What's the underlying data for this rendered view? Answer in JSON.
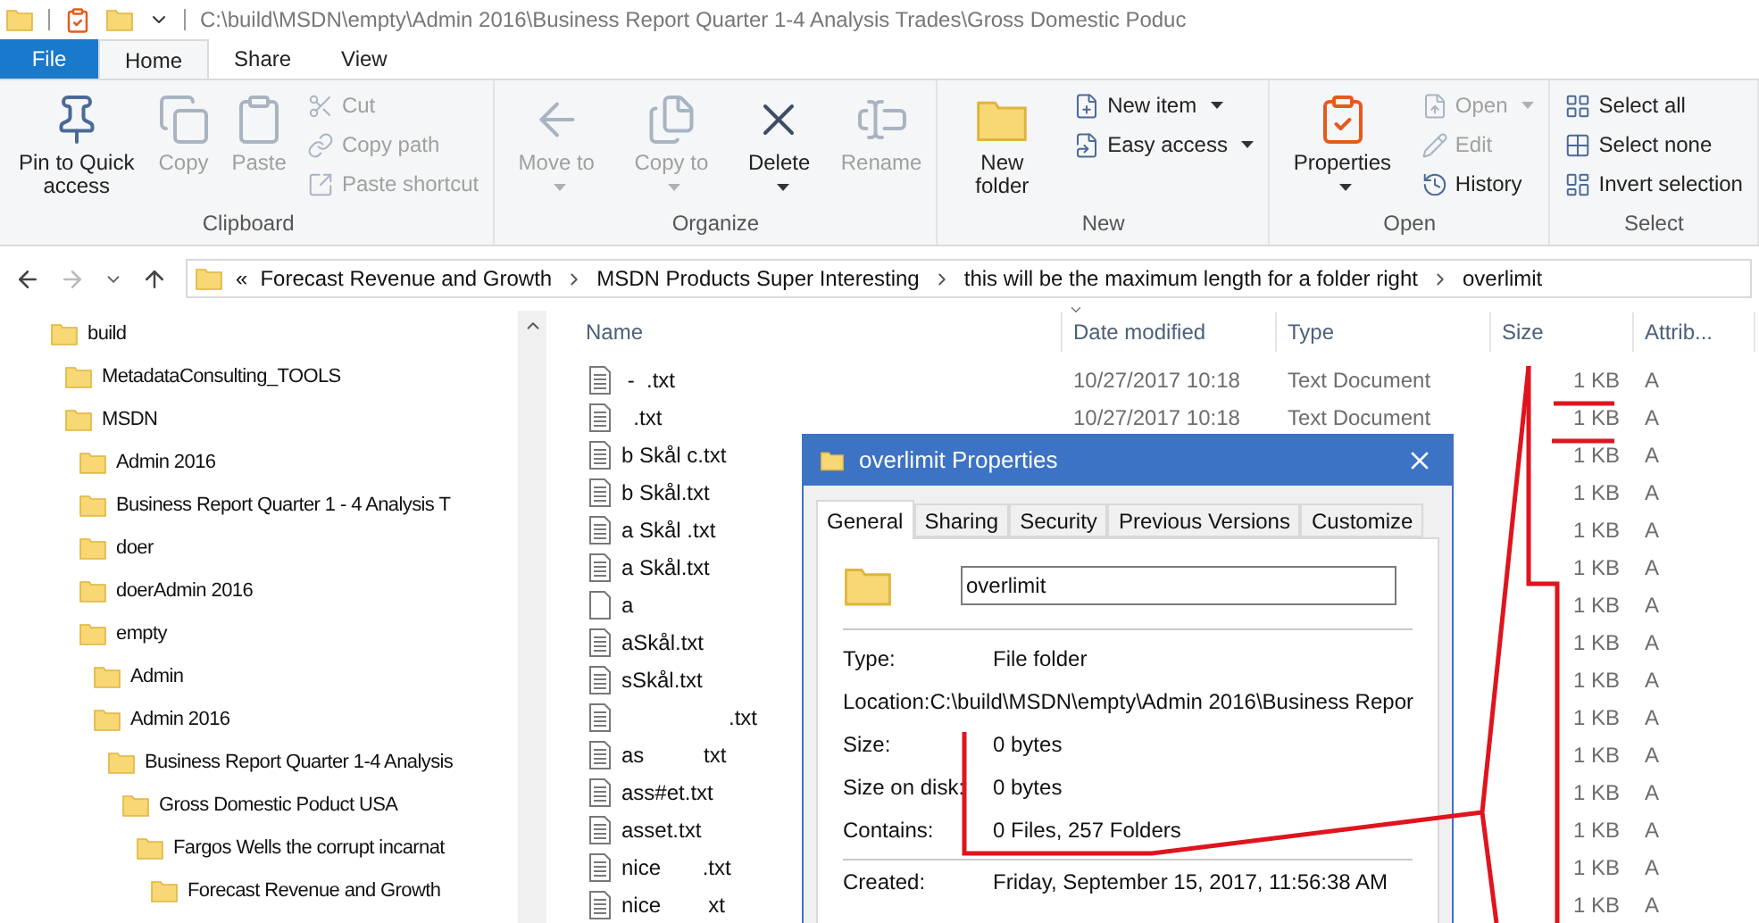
{
  "title_bar": {
    "path": "C:\\build\\MSDN\\empty\\Admin 2016\\Business Report Quarter 1-4 Analysis Trades\\Gross Domestic Poduc"
  },
  "ribbon_tabs": [
    {
      "label": "File",
      "kind": "file",
      "selected": false
    },
    {
      "label": "Home",
      "kind": "tab",
      "selected": true
    },
    {
      "label": "Share",
      "kind": "tab",
      "selected": false
    },
    {
      "label": "View",
      "kind": "tab",
      "selected": false
    }
  ],
  "ribbon_groups": [
    {
      "label": "Clipboard",
      "items": [
        {
          "label": "Pin to Quick access",
          "kind": "large",
          "disabled": false,
          "dropdown": false
        },
        {
          "label": "Copy",
          "kind": "large",
          "disabled": true,
          "dropdown": false
        },
        {
          "label": "Paste",
          "kind": "large",
          "disabled": true,
          "dropdown": false
        },
        {
          "label": "Cut",
          "kind": "small",
          "disabled": true,
          "dropdown": false
        },
        {
          "label": "Copy path",
          "kind": "small",
          "disabled": true,
          "dropdown": false
        },
        {
          "label": "Paste shortcut",
          "kind": "small",
          "disabled": true,
          "dropdown": false
        }
      ]
    },
    {
      "label": "Organize",
      "items": [
        {
          "label": "Move to",
          "kind": "large",
          "disabled": true,
          "dropdown": true
        },
        {
          "label": "Copy to",
          "kind": "large",
          "disabled": true,
          "dropdown": true
        },
        {
          "label": "Delete",
          "kind": "large",
          "disabled": false,
          "dropdown": true
        },
        {
          "label": "Rename",
          "kind": "large",
          "disabled": true,
          "dropdown": false
        }
      ]
    },
    {
      "label": "New",
      "items": [
        {
          "label": "New folder",
          "kind": "large",
          "disabled": false,
          "dropdown": false
        },
        {
          "label": "New item",
          "kind": "small",
          "disabled": false,
          "dropdown": true
        },
        {
          "label": "Easy access",
          "kind": "small",
          "disabled": false,
          "dropdown": true
        }
      ]
    },
    {
      "label": "Open",
      "items": [
        {
          "label": "Properties",
          "kind": "large",
          "disabled": false,
          "dropdown": true
        },
        {
          "label": "Open",
          "kind": "small",
          "disabled": true,
          "dropdown": true
        },
        {
          "label": "Edit",
          "kind": "small",
          "disabled": true,
          "dropdown": false
        },
        {
          "label": "History",
          "kind": "small",
          "disabled": false,
          "dropdown": false
        }
      ]
    },
    {
      "label": "Select",
      "items": [
        {
          "label": "Select all",
          "kind": "small",
          "disabled": false,
          "dropdown": false
        },
        {
          "label": "Select none",
          "kind": "small",
          "disabled": false,
          "dropdown": false
        },
        {
          "label": "Invert selection",
          "kind": "small",
          "disabled": false,
          "dropdown": false
        }
      ]
    }
  ],
  "address_bar": {
    "overflow": "«",
    "crumbs": [
      "Forecast Revenue and Growth",
      "MSDN Products Super Interesting",
      "this will be the maximum length for a folder right",
      "overlimit"
    ]
  },
  "nav_tree": [
    {
      "label": "build",
      "children": [
        {
          "label": "MetadataConsulting_TOOLS"
        },
        {
          "label": "MSDN",
          "children": [
            {
              "label": "Admin 2016"
            },
            {
              "label": "Business Report Quarter 1 - 4 Analysis T"
            },
            {
              "label": "doer"
            },
            {
              "label": "doerAdmin 2016"
            },
            {
              "label": "empty",
              "children": [
                {
                  "label": "Admin"
                },
                {
                  "label": "Admin 2016",
                  "children": [
                    {
                      "label": "Business Report Quarter 1-4 Analysis",
                      "children": [
                        {
                          "label": "Gross Domestic Poduct USA",
                          "children": [
                            {
                              "label": "Fargos Wells the corrupt incarnat",
                              "children": [
                                {
                                  "label": "Forecast Revenue and Growth"
                                }
                              ]
                            }
                          ]
                        }
                      ]
                    }
                  ]
                }
              ]
            }
          ]
        }
      ]
    }
  ],
  "file_list": {
    "columns": [
      "Name",
      "Date modified",
      "Type",
      "Size",
      "Attrib..."
    ],
    "rows": [
      {
        "name": " -  .txt",
        "kind": "text",
        "date": "10/27/2017 10:18",
        "type": "Text Document",
        "size": "1 KB",
        "attrib": "A"
      },
      {
        "name": "  .txt",
        "kind": "text",
        "date": "10/27/2017 10:18",
        "type": "Text Document",
        "size": "1 KB",
        "attrib": "A"
      },
      {
        "name": "b Skål c.txt",
        "kind": "text",
        "size": "1 KB",
        "attrib": "A"
      },
      {
        "name": "b Skål.txt",
        "kind": "text",
        "size": "1 KB",
        "attrib": "A"
      },
      {
        "name": "a Skål .txt",
        "kind": "text",
        "size": "1 KB",
        "attrib": "A"
      },
      {
        "name": "a Skål.txt",
        "kind": "text",
        "size": "1 KB",
        "attrib": "A"
      },
      {
        "name": "a",
        "kind": "blank",
        "size": "1 KB",
        "attrib": "A"
      },
      {
        "name": "aSkål.txt",
        "kind": "text",
        "size": "1 KB",
        "attrib": "A"
      },
      {
        "name": "sSkål.txt",
        "kind": "text",
        "size": "1 KB",
        "attrib": "A"
      },
      {
        "name": "                  .txt",
        "kind": "text",
        "size": "1 KB",
        "attrib": "A"
      },
      {
        "name": "as          txt",
        "kind": "text",
        "size": "1 KB",
        "attrib": "A"
      },
      {
        "name": "ass#et.txt",
        "kind": "text",
        "size": "1 KB",
        "attrib": "A"
      },
      {
        "name": "asset.txt",
        "kind": "text",
        "size": "1 KB",
        "attrib": "A"
      },
      {
        "name": "nice       .txt",
        "kind": "text",
        "size": "1 KB",
        "attrib": "A"
      },
      {
        "name": "nice        xt",
        "kind": "text",
        "size": "1 KB",
        "attrib": "A"
      }
    ]
  },
  "properties_dialog": {
    "title": "overlimit Properties",
    "tabs": [
      {
        "label": "General",
        "selected": true
      },
      {
        "label": "Sharing",
        "selected": false
      },
      {
        "label": "Security",
        "selected": false
      },
      {
        "label": "Previous Versions",
        "selected": false
      },
      {
        "label": "Customize",
        "selected": false
      }
    ],
    "name_value": "overlimit",
    "fields": [
      {
        "label": "Type:",
        "value": "File folder"
      },
      {
        "label": "Location:",
        "value": "C:\\build\\MSDN\\empty\\Admin 2016\\Business Repor"
      },
      {
        "label": "Size:",
        "value": "0 bytes"
      },
      {
        "label": "Size on disk:",
        "value": "0 bytes"
      },
      {
        "label": "Contains:",
        "value": "0 Files, 257 Folders"
      }
    ],
    "created": {
      "label": "Created:",
      "value": "Friday, September 15, 2017, 11:56:38 AM"
    }
  }
}
